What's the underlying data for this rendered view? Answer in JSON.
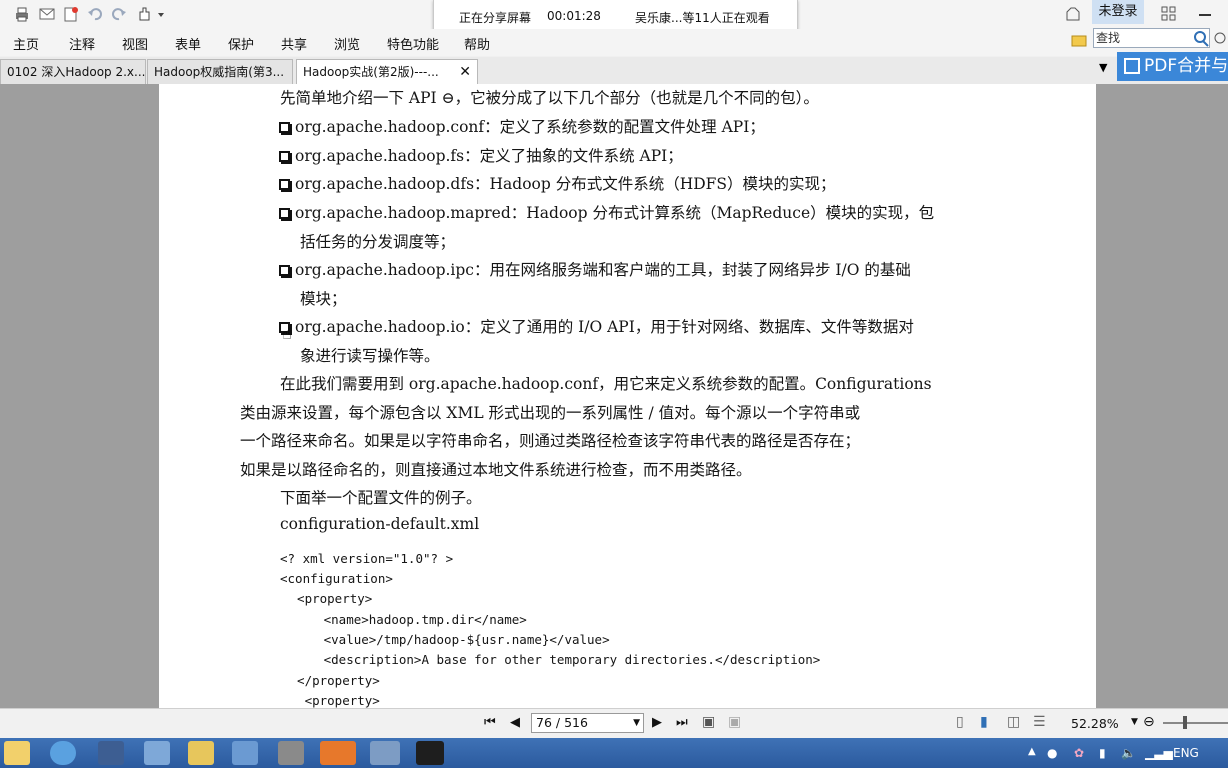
{
  "share_banner": {
    "status": "正在分享屏幕",
    "timer": "00:01:28",
    "viewers": "吴乐康...等11人正在观看"
  },
  "login_label": "未登录",
  "menu": [
    "主页",
    "注释",
    "视图",
    "表单",
    "保护",
    "共享",
    "浏览",
    "特色功能",
    "帮助"
  ],
  "search": {
    "placeholder": "查找"
  },
  "tabs": [
    {
      "label": "0102 深入Hadoop 2.x..."
    },
    {
      "label": "Hadoop权威指南(第3..."
    },
    {
      "label": "Hadoop实战(第2版)---..."
    }
  ],
  "pdf_merge_label": "PDF合并与",
  "document": {
    "intro": "先简单地介绍一下 API ⊖，它被分成了以下几个部分（也就是几个不同的包）。",
    "bullets": [
      {
        "l1": "org.apache.hadoop.conf：定义了系统参数的配置文件处理 API；"
      },
      {
        "l1": "org.apache.hadoop.fs：定义了抽象的文件系统 API；"
      },
      {
        "l1": "org.apache.hadoop.dfs：Hadoop 分布式文件系统（HDFS）模块的实现；"
      },
      {
        "l1": "org.apache.hadoop.mapred：Hadoop 分布式计算系统（MapReduce）模块的实现，包",
        "l2": "括任务的分发调度等；"
      },
      {
        "l1": "org.apache.hadoop.ipc：用在网络服务端和客户端的工具，封装了网络异步 I/O 的基础",
        "l2": "模块；"
      },
      {
        "l1": "org.apache.hadoop.io：定义了通用的 I/O API，用于针对网络、数据库、文件等数据对",
        "l2": "象进行读写操作等。"
      }
    ],
    "para": [
      "在此我们需要用到 org.apache.hadoop.conf，用它来定义系统参数的配置。Configurations",
      "类由源来设置，每个源包含以 XML 形式出现的一系列属性 / 值对。每个源以一个字符串或",
      "一个路径来命名。如果是以字符串命名，则通过类路径检查该字符串代表的路径是否存在；",
      "如果是以路径命名的，则直接通过本地文件系统进行检查，而不用类路径。"
    ],
    "example_intro": "下面举一个配置文件的例子。",
    "filename": "configuration-default.xml",
    "code": [
      "<? xml version=\"1.0\"? >",
      "<configuration>",
      "  <property>",
      "     <name>hadoop.tmp.dir</name>",
      "     <value>/tmp/hadoop-${usr.name}</value>",
      "     <description>A base for other temporary directories.</description>",
      "  </property>",
      "   <property>"
    ]
  },
  "status": {
    "page_indicator": "76 / 516",
    "zoom": "52.28%"
  },
  "tray": {
    "lang": "ENG"
  },
  "colors": {
    "accent": "#3b87d8",
    "taskbar": "#2f62a8"
  }
}
